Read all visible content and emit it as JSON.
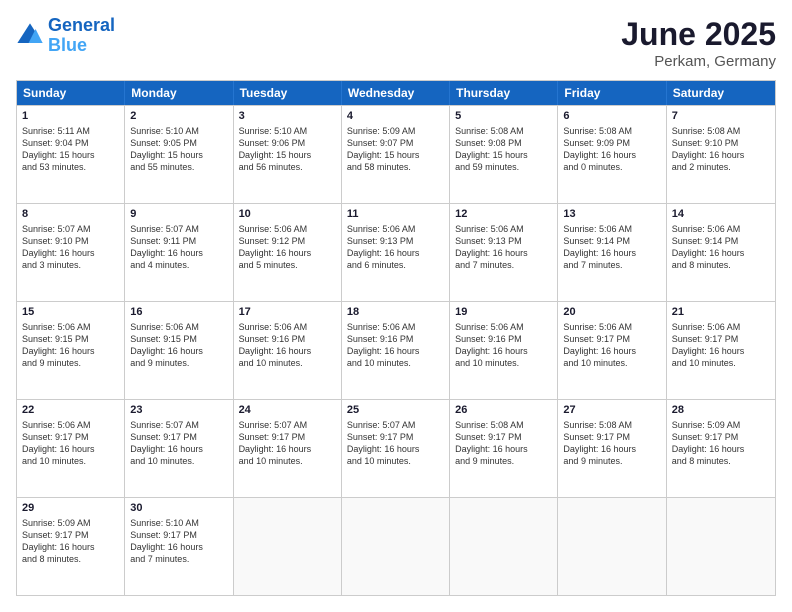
{
  "logo": {
    "line1": "General",
    "line2": "Blue"
  },
  "title": "June 2025",
  "subtitle": "Perkam, Germany",
  "header_days": [
    "Sunday",
    "Monday",
    "Tuesday",
    "Wednesday",
    "Thursday",
    "Friday",
    "Saturday"
  ],
  "weeks": [
    [
      {
        "day": "1",
        "lines": [
          "Sunrise: 5:11 AM",
          "Sunset: 9:04 PM",
          "Daylight: 15 hours",
          "and 53 minutes."
        ]
      },
      {
        "day": "2",
        "lines": [
          "Sunrise: 5:10 AM",
          "Sunset: 9:05 PM",
          "Daylight: 15 hours",
          "and 55 minutes."
        ]
      },
      {
        "day": "3",
        "lines": [
          "Sunrise: 5:10 AM",
          "Sunset: 9:06 PM",
          "Daylight: 15 hours",
          "and 56 minutes."
        ]
      },
      {
        "day": "4",
        "lines": [
          "Sunrise: 5:09 AM",
          "Sunset: 9:07 PM",
          "Daylight: 15 hours",
          "and 58 minutes."
        ]
      },
      {
        "day": "5",
        "lines": [
          "Sunrise: 5:08 AM",
          "Sunset: 9:08 PM",
          "Daylight: 15 hours",
          "and 59 minutes."
        ]
      },
      {
        "day": "6",
        "lines": [
          "Sunrise: 5:08 AM",
          "Sunset: 9:09 PM",
          "Daylight: 16 hours",
          "and 0 minutes."
        ]
      },
      {
        "day": "7",
        "lines": [
          "Sunrise: 5:08 AM",
          "Sunset: 9:10 PM",
          "Daylight: 16 hours",
          "and 2 minutes."
        ]
      }
    ],
    [
      {
        "day": "8",
        "lines": [
          "Sunrise: 5:07 AM",
          "Sunset: 9:10 PM",
          "Daylight: 16 hours",
          "and 3 minutes."
        ]
      },
      {
        "day": "9",
        "lines": [
          "Sunrise: 5:07 AM",
          "Sunset: 9:11 PM",
          "Daylight: 16 hours",
          "and 4 minutes."
        ]
      },
      {
        "day": "10",
        "lines": [
          "Sunrise: 5:06 AM",
          "Sunset: 9:12 PM",
          "Daylight: 16 hours",
          "and 5 minutes."
        ]
      },
      {
        "day": "11",
        "lines": [
          "Sunrise: 5:06 AM",
          "Sunset: 9:13 PM",
          "Daylight: 16 hours",
          "and 6 minutes."
        ]
      },
      {
        "day": "12",
        "lines": [
          "Sunrise: 5:06 AM",
          "Sunset: 9:13 PM",
          "Daylight: 16 hours",
          "and 7 minutes."
        ]
      },
      {
        "day": "13",
        "lines": [
          "Sunrise: 5:06 AM",
          "Sunset: 9:14 PM",
          "Daylight: 16 hours",
          "and 7 minutes."
        ]
      },
      {
        "day": "14",
        "lines": [
          "Sunrise: 5:06 AM",
          "Sunset: 9:14 PM",
          "Daylight: 16 hours",
          "and 8 minutes."
        ]
      }
    ],
    [
      {
        "day": "15",
        "lines": [
          "Sunrise: 5:06 AM",
          "Sunset: 9:15 PM",
          "Daylight: 16 hours",
          "and 9 minutes."
        ]
      },
      {
        "day": "16",
        "lines": [
          "Sunrise: 5:06 AM",
          "Sunset: 9:15 PM",
          "Daylight: 16 hours",
          "and 9 minutes."
        ]
      },
      {
        "day": "17",
        "lines": [
          "Sunrise: 5:06 AM",
          "Sunset: 9:16 PM",
          "Daylight: 16 hours",
          "and 10 minutes."
        ]
      },
      {
        "day": "18",
        "lines": [
          "Sunrise: 5:06 AM",
          "Sunset: 9:16 PM",
          "Daylight: 16 hours",
          "and 10 minutes."
        ]
      },
      {
        "day": "19",
        "lines": [
          "Sunrise: 5:06 AM",
          "Sunset: 9:16 PM",
          "Daylight: 16 hours",
          "and 10 minutes."
        ]
      },
      {
        "day": "20",
        "lines": [
          "Sunrise: 5:06 AM",
          "Sunset: 9:17 PM",
          "Daylight: 16 hours",
          "and 10 minutes."
        ]
      },
      {
        "day": "21",
        "lines": [
          "Sunrise: 5:06 AM",
          "Sunset: 9:17 PM",
          "Daylight: 16 hours",
          "and 10 minutes."
        ]
      }
    ],
    [
      {
        "day": "22",
        "lines": [
          "Sunrise: 5:06 AM",
          "Sunset: 9:17 PM",
          "Daylight: 16 hours",
          "and 10 minutes."
        ]
      },
      {
        "day": "23",
        "lines": [
          "Sunrise: 5:07 AM",
          "Sunset: 9:17 PM",
          "Daylight: 16 hours",
          "and 10 minutes."
        ]
      },
      {
        "day": "24",
        "lines": [
          "Sunrise: 5:07 AM",
          "Sunset: 9:17 PM",
          "Daylight: 16 hours",
          "and 10 minutes."
        ]
      },
      {
        "day": "25",
        "lines": [
          "Sunrise: 5:07 AM",
          "Sunset: 9:17 PM",
          "Daylight: 16 hours",
          "and 10 minutes."
        ]
      },
      {
        "day": "26",
        "lines": [
          "Sunrise: 5:08 AM",
          "Sunset: 9:17 PM",
          "Daylight: 16 hours",
          "and 9 minutes."
        ]
      },
      {
        "day": "27",
        "lines": [
          "Sunrise: 5:08 AM",
          "Sunset: 9:17 PM",
          "Daylight: 16 hours",
          "and 9 minutes."
        ]
      },
      {
        "day": "28",
        "lines": [
          "Sunrise: 5:09 AM",
          "Sunset: 9:17 PM",
          "Daylight: 16 hours",
          "and 8 minutes."
        ]
      }
    ],
    [
      {
        "day": "29",
        "lines": [
          "Sunrise: 5:09 AM",
          "Sunset: 9:17 PM",
          "Daylight: 16 hours",
          "and 8 minutes."
        ]
      },
      {
        "day": "30",
        "lines": [
          "Sunrise: 5:10 AM",
          "Sunset: 9:17 PM",
          "Daylight: 16 hours",
          "and 7 minutes."
        ]
      },
      {
        "day": "",
        "lines": []
      },
      {
        "day": "",
        "lines": []
      },
      {
        "day": "",
        "lines": []
      },
      {
        "day": "",
        "lines": []
      },
      {
        "day": "",
        "lines": []
      }
    ]
  ]
}
